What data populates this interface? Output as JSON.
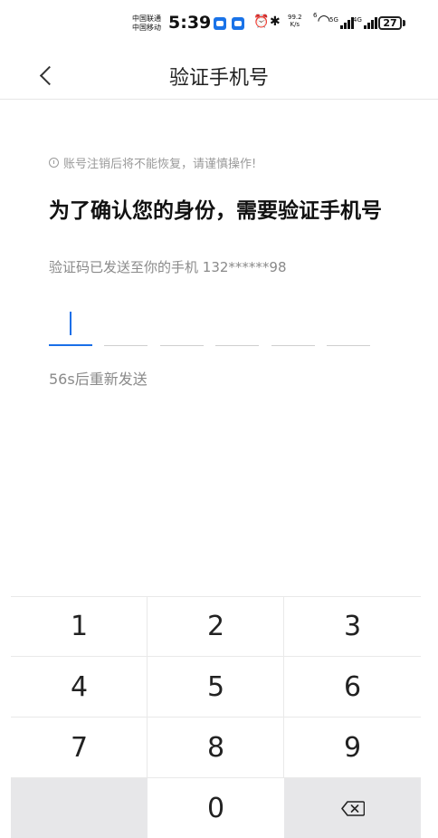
{
  "status_bar": {
    "carrier_1": "中国联通",
    "carrier_2": "中国移动",
    "time": "5:39",
    "net_speed_value": "99.2",
    "net_speed_unit": "K/s",
    "wifi_label": "6",
    "sig1_label": "5G",
    "sig2_label": "4G",
    "battery": "27"
  },
  "header": {
    "title": "验证手机号"
  },
  "content": {
    "warning": "账号注销后将不能恢复，请谨慎操作!",
    "headline": "为了确认您的身份，需要验证手机号",
    "sent_message": "验证码已发送至你的手机 132******98",
    "resend": "56s后重新发送"
  },
  "code_input": {
    "length": 6,
    "active_index": 0
  },
  "keypad": {
    "keys": [
      "1",
      "2",
      "3",
      "4",
      "5",
      "6",
      "7",
      "8",
      "9",
      "0"
    ]
  }
}
